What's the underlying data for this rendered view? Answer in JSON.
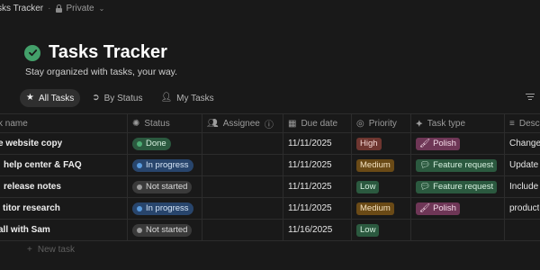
{
  "topbar": {
    "breadcrumb": "sks Tracker",
    "privacy": "Private"
  },
  "page": {
    "title": "Tasks Tracker",
    "subtitle": "Stay organized with tasks, your way."
  },
  "tabs": [
    {
      "label": "All Tasks",
      "icon": "star-icon"
    },
    {
      "label": "By Status",
      "icon": "circle-arrow-icon"
    },
    {
      "label": "My Tasks",
      "icon": "person-icon"
    }
  ],
  "columns": {
    "name": "k name",
    "status": "Status",
    "assignee": "Assignee",
    "due": "Due date",
    "priority": "Priority",
    "type": "Task type",
    "desc": "Desc"
  },
  "rows": [
    {
      "name": "e website copy",
      "status": "Done",
      "due": "11/11/2025",
      "priority": "High",
      "type": "Polish",
      "desc": "Change"
    },
    {
      "name": "help center & FAQ",
      "status": "In progress",
      "due": "11/11/2025",
      "priority": "Medium",
      "type": "Feature request",
      "desc": "Update s"
    },
    {
      "name": "release notes",
      "status": "Not started",
      "due": "11/11/2025",
      "priority": "Low",
      "type": "Feature request",
      "desc": "Include p"
    },
    {
      "name": "titor research",
      "status": "In progress",
      "due": "11/11/2025",
      "priority": "Medium",
      "type": "Polish",
      "desc": "product"
    },
    {
      "name": "all with Sam",
      "status": "Not started",
      "due": "11/16/2025",
      "priority": "Low",
      "type": "",
      "desc": ""
    }
  ],
  "new_task": "New task",
  "colors": {
    "background": "#191919",
    "done": "#2b593f",
    "done_dot": "#4dab74",
    "in_progress": "#28456c",
    "in_progress_dot": "#5a9bdd",
    "not_started": "#3a3a3a",
    "not_started_dot": "#9b9b9b",
    "high": "#6e3630",
    "medium": "#6a4a16",
    "low": "#2b593f",
    "polish": "#6e3656",
    "feature": "#2b593f"
  }
}
